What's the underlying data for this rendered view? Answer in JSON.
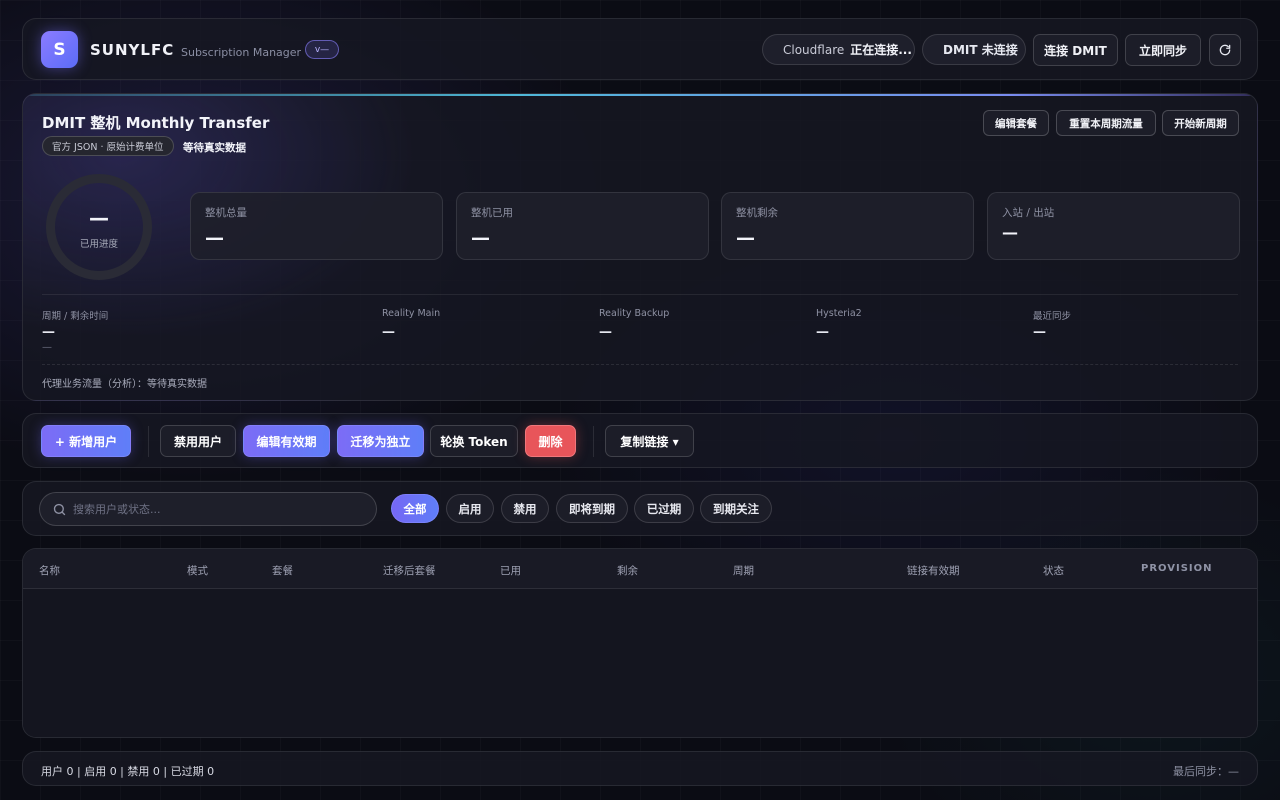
{
  "header": {
    "logo_letter": "S",
    "brand": "SUNYLFC",
    "subtitle": "Subscription Manager",
    "version": "v—",
    "cloudflare": {
      "name": "Cloudflare",
      "status": "正在连接..."
    },
    "dmit_status": "DMIT 未连接",
    "connect_dmit": "连接 DMIT",
    "sync_now": "立即同步",
    "refresh_icon": "refresh-icon"
  },
  "overview": {
    "title": "DMIT 整机 Monthly Transfer",
    "tag": "官方 JSON · 原始计费单位",
    "waiting": "等待真实数据",
    "buttons": {
      "edit_plan": "编辑套餐",
      "reset_traffic": "重置本周期流量",
      "new_cycle": "开始新周期"
    },
    "progress": {
      "value": "—",
      "label": "已用进度"
    },
    "stats": [
      {
        "label": "整机总量",
        "value": "—"
      },
      {
        "label": "整机已用",
        "value": "—"
      },
      {
        "label": "整机剩余",
        "value": "—"
      },
      {
        "label": "入站 / 出站",
        "value": "—"
      }
    ],
    "meta": [
      {
        "label": "周期 / 剩余时间",
        "value": "—",
        "sub": "—"
      },
      {
        "label": "Reality Main",
        "value": "—"
      },
      {
        "label": "Reality Backup",
        "value": "—"
      },
      {
        "label": "Hysteria2",
        "value": "—"
      },
      {
        "label": "最近同步",
        "value": "—"
      }
    ],
    "footer": "代理业务流量（分析）：等待真实数据"
  },
  "actions": {
    "add_user": "+ 新增用户",
    "disable_user": "禁用用户",
    "edit_validity": "编辑有效期",
    "migrate": "迁移为独立",
    "rotate_token": "轮换 Token",
    "delete": "删除",
    "copy_link": "复制链接 ▾"
  },
  "filter": {
    "search_placeholder": "搜索用户或状态...",
    "chips": [
      "全部",
      "启用",
      "禁用",
      "即将到期",
      "已过期",
      "到期关注"
    ],
    "active": "全部"
  },
  "table": {
    "columns": [
      "名称",
      "模式",
      "套餐",
      "迁移后套餐",
      "已用",
      "剩余",
      "周期",
      "链接有效期",
      "状态",
      "PROVISION"
    ],
    "rows": []
  },
  "footer": {
    "summary": "用户 0 | 启用 0 | 禁用 0 | 已过期 0",
    "last_sync": "最后同步：—"
  },
  "colors": {
    "accent": "#6f6cf6",
    "danger": "#e8555a",
    "connecting_dot": "#9a9db0",
    "dmit_dot": "#2fd3b8",
    "accent_line": "#4fb8d8"
  }
}
